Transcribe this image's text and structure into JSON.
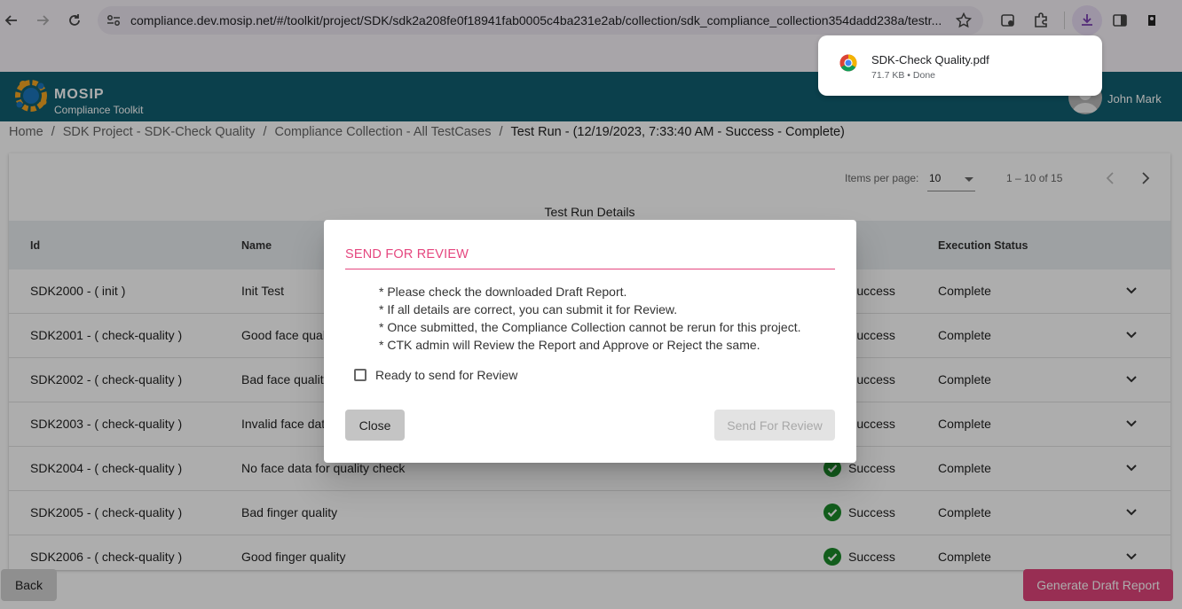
{
  "browser": {
    "url": "compliance.dev.mosip.net/#/toolkit/project/SDK/sdk2a208fe0f18941fab0005c4ba231e2ab/collection/sdk_compliance_collection354dadd238a/testr...",
    "icons": [
      "back-arrow-icon",
      "forward-arrow-icon",
      "reload-icon",
      "site-info-icon",
      "star-icon",
      "extension-icon",
      "puzzle-icon",
      "download-icon",
      "sidepanel-icon",
      "profile-icon"
    ]
  },
  "download": {
    "filename": "SDK-Check Quality.pdf",
    "size": "71.7 KB",
    "separator": "•",
    "status": "Done"
  },
  "app": {
    "brand": "MOSIP",
    "subtitle": "Compliance Toolkit",
    "user": "John Mark"
  },
  "breadcrumb": {
    "items": [
      "Home",
      "SDK Project - SDK-Check Quality",
      "Compliance Collection - All TestCases"
    ],
    "current": "Test Run - (12/19/2023, 7:33:40 AM - Success - Complete)",
    "separator": "/"
  },
  "pager": {
    "label": "Items per page:",
    "page_size": "10",
    "range": "1 – 10 of 15"
  },
  "table": {
    "caption": "Test Run Details",
    "headers": {
      "id": "Id",
      "name": "Name",
      "execution": "Execution Status"
    },
    "rows": [
      {
        "id": "SDK2000 - ( init )",
        "name": "Init Test",
        "status": "Success",
        "execution": "Complete"
      },
      {
        "id": "SDK2001 - ( check-quality )",
        "name": "Good face quality",
        "status": "Success",
        "execution": "Complete"
      },
      {
        "id": "SDK2002 - ( check-quality )",
        "name": "Bad face quality",
        "status": "Success",
        "execution": "Complete"
      },
      {
        "id": "SDK2003 - ( check-quality )",
        "name": "Invalid face data",
        "status": "Success",
        "execution": "Complete"
      },
      {
        "id": "SDK2004 - ( check-quality )",
        "name": "No face data for quality check",
        "status": "Success",
        "execution": "Complete"
      },
      {
        "id": "SDK2005 - ( check-quality )",
        "name": "Bad finger quality",
        "status": "Success",
        "execution": "Complete"
      },
      {
        "id": "SDK2006 - ( check-quality )",
        "name": "Good finger quality",
        "status": "Success",
        "execution": "Complete"
      }
    ]
  },
  "footer": {
    "back": "Back",
    "generate": "Generate Draft Report"
  },
  "dialog": {
    "title": "SEND FOR REVIEW",
    "notes": [
      "* Please check the downloaded Draft Report.",
      "* If all details are correct, you can submit it for Review.",
      "* Once submitted, the Compliance Collection cannot be rerun for this project.",
      "* CTK admin will Review the Report and Approve or Reject the same."
    ],
    "checkbox_label": "Ready to send for Review",
    "close": "Close",
    "send": "Send For Review"
  },
  "colors": {
    "appbar": "#115f70",
    "accent_pink": "#e5477f",
    "success_green": "#1b8a2a",
    "generate_button": "#e0457b"
  }
}
